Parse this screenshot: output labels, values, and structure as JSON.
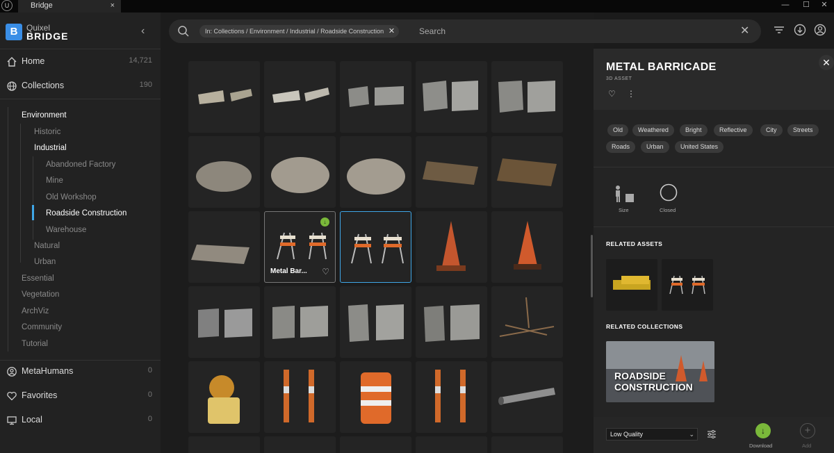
{
  "titlebar": {
    "tab": "Bridge",
    "tab_close": "×",
    "minimize": "—",
    "maximize": "☐",
    "close": "✕"
  },
  "brand": {
    "line1": "Quixel",
    "line2": "BRIDGE",
    "mark": "B"
  },
  "sidebar": {
    "home": {
      "label": "Home",
      "count": "14,721"
    },
    "collections": {
      "label": "Collections",
      "count": "190"
    },
    "tree": {
      "environment": "Environment",
      "historic": "Historic",
      "industrial": "Industrial",
      "abandoned_factory": "Abandoned Factory",
      "mine": "Mine",
      "old_workshop": "Old Workshop",
      "roadside_construction": "Roadside Construction",
      "warehouse": "Warehouse",
      "natural": "Natural",
      "urban": "Urban",
      "essential": "Essential",
      "vegetation": "Vegetation",
      "archviz": "ArchViz",
      "community": "Community",
      "tutorial": "Tutorial"
    },
    "metahumans": {
      "label": "MetaHumans",
      "count": "0"
    },
    "favorites": {
      "label": "Favorites",
      "count": "0"
    },
    "local": {
      "label": "Local",
      "count": "0"
    }
  },
  "search": {
    "chip": "In: Collections / Environment / Industrial / Roadside Construction",
    "placeholder": "Search"
  },
  "grid": {
    "hover_name": "Metal Bar..."
  },
  "detail": {
    "title": "METAL BARRICADE",
    "type": "3D ASSET",
    "tags": [
      "Old",
      "Weathered",
      "Bright",
      "Reflective",
      "City",
      "Streets",
      "Roads",
      "Urban",
      "United States"
    ],
    "spec_size": "Size",
    "spec_closed": "Closed",
    "related_assets": "RELATED ASSETS",
    "related_collections": "RELATED COLLECTIONS",
    "collection_name_1": "ROADSIDE",
    "collection_name_2": "CONSTRUCTION",
    "quality": "Low Quality",
    "download": "Download",
    "add": "Add"
  },
  "colors": {
    "accent": "#3fa7e8",
    "download": "#7ab83a",
    "brand": "#3a8ee6"
  }
}
